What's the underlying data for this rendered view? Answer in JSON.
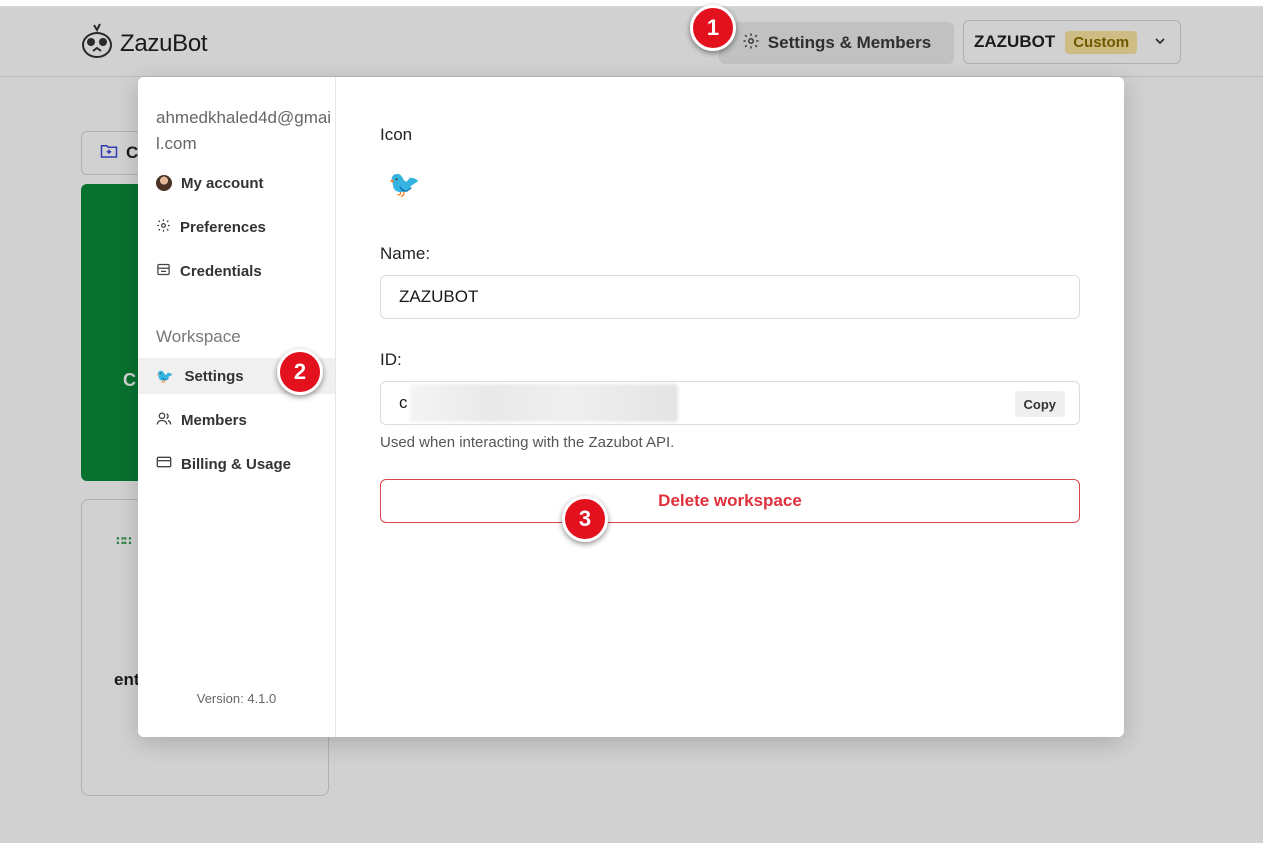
{
  "header": {
    "logo_text": "ZazuBot",
    "settings_label": "Settings & Members",
    "workspace_name": "ZAZUBOT",
    "workspace_plan": "Custom"
  },
  "background": {
    "folder_button_label": "C",
    "green_card_label": "C",
    "card_text": "ent"
  },
  "sidebar": {
    "email": "ahmedkhaled4d@gmail.com",
    "account_items": [
      {
        "label": "My account",
        "icon": "avatar"
      },
      {
        "label": "Preferences",
        "icon": "gear-icon"
      },
      {
        "label": "Credentials",
        "icon": "credentials-icon"
      }
    ],
    "workspace_section": "Workspace",
    "workspace_items": [
      {
        "label": "Settings",
        "icon": "bird-emoji",
        "active": true
      },
      {
        "label": "Members",
        "icon": "users-icon"
      },
      {
        "label": "Billing & Usage",
        "icon": "card-icon"
      }
    ],
    "version": "Version: 4.1.0"
  },
  "settings": {
    "icon_label": "Icon",
    "icon_emoji": "🐦",
    "name_label": "Name:",
    "name_value": "ZAZUBOT",
    "id_label": "ID:",
    "id_value_visible": "c",
    "copy_label": "Copy",
    "id_hint": "Used when interacting with the Zazubot API.",
    "delete_label": "Delete workspace"
  },
  "markers": [
    "1",
    "2",
    "3"
  ],
  "colors": {
    "accent_danger": "#e0303c",
    "marker_red": "#e3101e",
    "badge_bg": "#fbe7a1",
    "green_card": "#0a8a3a"
  }
}
